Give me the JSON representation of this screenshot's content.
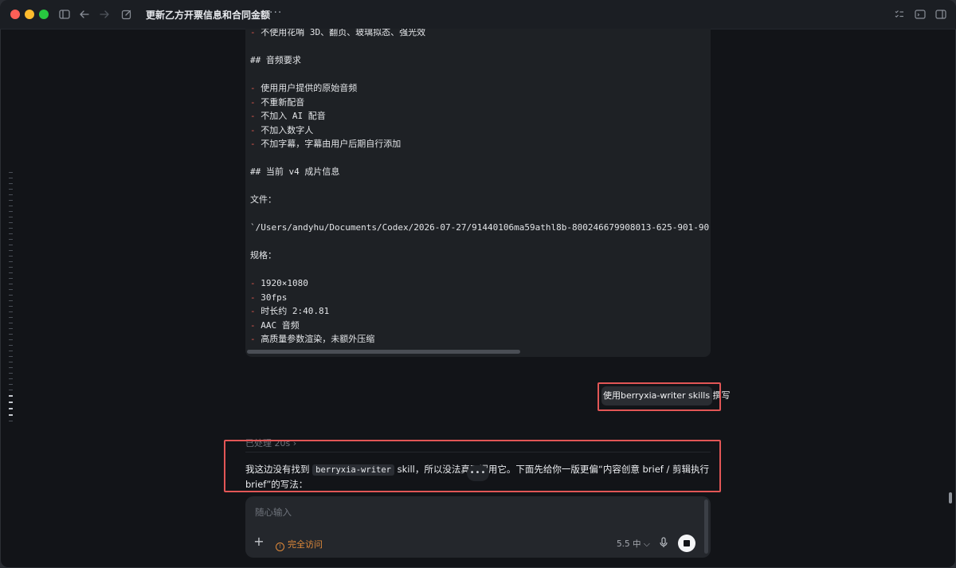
{
  "window": {
    "title": "更新乙方开票信息和合同金额",
    "more_label": "···"
  },
  "code_block": {
    "lines": [
      {
        "bullet": "-",
        "text": " 不使用花哨 3D、翻页、玻璃拟态、强光效"
      },
      {
        "bullet": "",
        "text": ""
      },
      {
        "bullet": "",
        "text": "## 音频要求"
      },
      {
        "bullet": "",
        "text": ""
      },
      {
        "bullet": "-",
        "text": " 使用用户提供的原始音频"
      },
      {
        "bullet": "-",
        "text": " 不重新配音"
      },
      {
        "bullet": "-",
        "text": " 不加入 AI 配音"
      },
      {
        "bullet": "-",
        "text": " 不加入数字人"
      },
      {
        "bullet": "-",
        "text": " 不加字幕，字幕由用户后期自行添加"
      },
      {
        "bullet": "",
        "text": ""
      },
      {
        "bullet": "",
        "text": "## 当前 v4 成片信息"
      },
      {
        "bullet": "",
        "text": ""
      },
      {
        "bullet": "",
        "text": "文件："
      },
      {
        "bullet": "",
        "text": ""
      },
      {
        "bullet": "",
        "text": "`/Users/andyhu/Documents/Codex/2026-07-27/91440106ma59athl8b-800246679908013-625-901-90"
      },
      {
        "bullet": "",
        "text": ""
      },
      {
        "bullet": "",
        "text": "规格："
      },
      {
        "bullet": "",
        "text": ""
      },
      {
        "bullet": "-",
        "text": " 1920×1080"
      },
      {
        "bullet": "-",
        "text": " 30fps"
      },
      {
        "bullet": "-",
        "text": " 时长约 2:40.81"
      },
      {
        "bullet": "-",
        "text": " AAC 音频"
      },
      {
        "bullet": "-",
        "text": " 高质量参数渲染，未额外压缩"
      }
    ]
  },
  "user_message": {
    "text": "使用berryxia-writer skills 撰写"
  },
  "assistant": {
    "processed_label": "已处理 20s  ›",
    "reply_before": "我这边没有找到 ",
    "reply_code": "berryxia-writer",
    "reply_after": " skill，所以没法真正调用它。下面先给你一版更偏“内容创意 brief / 剪辑执行 brief”的写法：",
    "thinking": "•••"
  },
  "composer": {
    "placeholder": "随心输入",
    "access_label": "完全访问",
    "model_label": "5.5 中 ⌵"
  },
  "colors": {
    "highlight_box": "#e25656",
    "bullet": "#e05a4e",
    "access": "#e08a3a"
  }
}
